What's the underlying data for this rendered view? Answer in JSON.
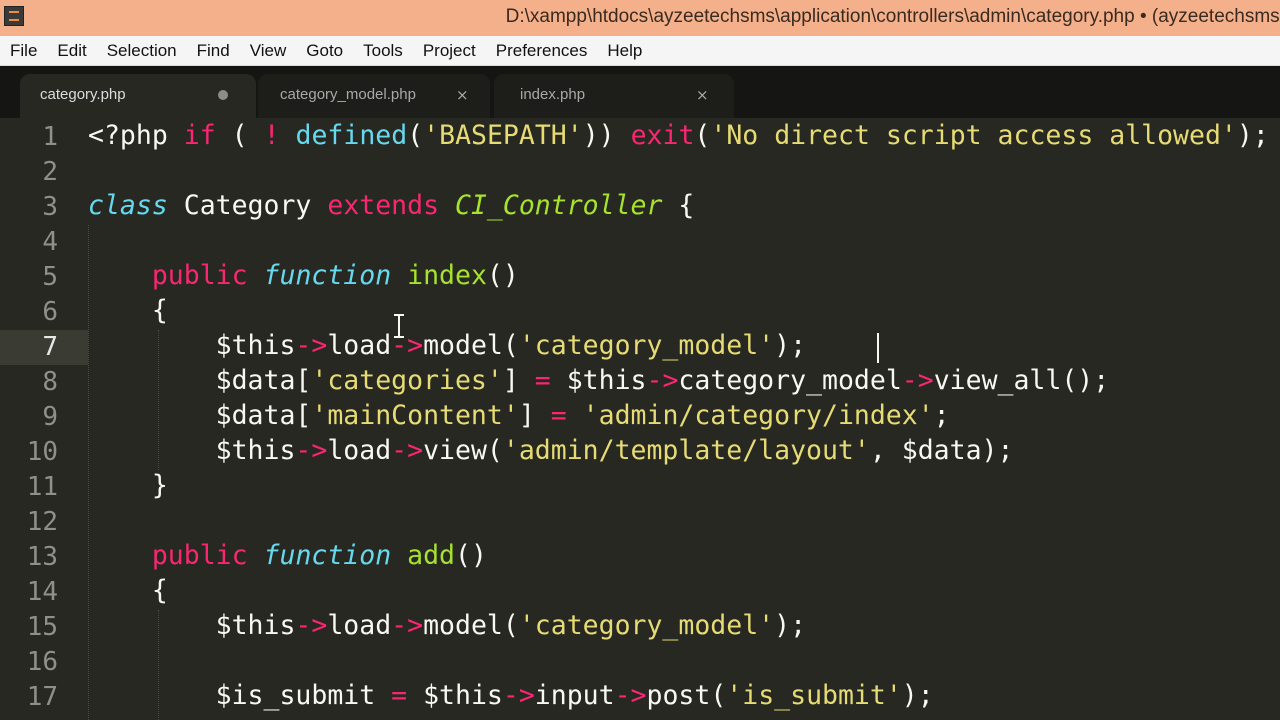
{
  "window": {
    "title": "D:\\xampp\\htdocs\\ayzeetechsms\\application\\controllers\\admin\\category.php • (ayzeetechsms)"
  },
  "menu": [
    "File",
    "Edit",
    "Selection",
    "Find",
    "View",
    "Goto",
    "Tools",
    "Project",
    "Preferences",
    "Help"
  ],
  "tabs": [
    {
      "label": "category.php",
      "state": "active-modified"
    },
    {
      "label": "category_model.php",
      "state": "closable"
    },
    {
      "label": "index.php",
      "state": "closable"
    }
  ],
  "tab_close_glyph": "×",
  "editor": {
    "current_line": 7,
    "line_numbers": [
      "1",
      "2",
      "3",
      "4",
      "5",
      "6",
      "7",
      "8",
      "9",
      "10",
      "11",
      "12",
      "13",
      "14",
      "15",
      "16",
      "17"
    ],
    "lines": [
      "<?php if ( ! defined('BASEPATH')) exit('No direct script access allowed');",
      "",
      "class Category extends CI_Controller {",
      "",
      "    public function index()",
      "    {",
      "        $this->load->model('category_model');",
      "        $data['categories'] = $this->category_model->view_all();",
      "        $data['mainContent'] = 'admin/category/index';",
      "        $this->load->view('admin/template/layout', $data);",
      "    }",
      "",
      "    public function add()",
      "    {",
      "        $this->load->model('category_model');",
      "",
      "        $is_submit = $this->input->post('is_submit');"
    ]
  },
  "colors": {
    "editor_bg": "#272822",
    "title_bar": "#f3b08a",
    "keyword": "#f92672",
    "storage": "#66d9ef",
    "entity": "#a6e22e",
    "string": "#e6db74",
    "text": "#f8f8f2"
  },
  "icons": {
    "app": "sublime-text-icon",
    "modified": "modified-dot-icon",
    "close": "close-icon",
    "cursor": "text-cursor-icon"
  }
}
